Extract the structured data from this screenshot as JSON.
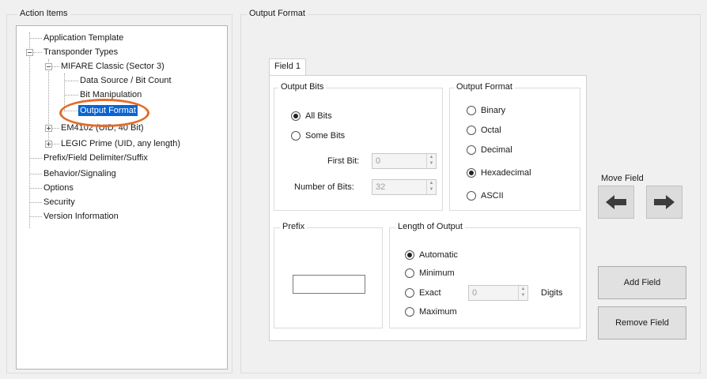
{
  "left_panel": {
    "title": "Action Items"
  },
  "tree": {
    "items": [
      {
        "label": "Application Template"
      },
      {
        "label": "Transponder Types"
      },
      {
        "label": "MIFARE Classic (Sector 3)"
      },
      {
        "label": "Data Source / Bit Count"
      },
      {
        "label": "Bit Manipulation"
      },
      {
        "label": "Output Format"
      },
      {
        "label": "EM4102 (UID, 40 Bit)"
      },
      {
        "label": "LEGIC Prime (UID, any length)"
      },
      {
        "label": "Prefix/Field Delimiter/Suffix"
      },
      {
        "label": "Behavior/Signaling"
      },
      {
        "label": "Options"
      },
      {
        "label": "Security"
      },
      {
        "label": "Version Information"
      }
    ]
  },
  "right_panel": {
    "title": "Output Format"
  },
  "tab": {
    "label": "Field 1"
  },
  "output_bits": {
    "title": "Output Bits",
    "all_bits": "All Bits",
    "some_bits": "Some Bits",
    "first_bit_label": "First Bit:",
    "first_bit_value": "0",
    "number_of_bits_label": "Number of Bits:",
    "number_of_bits_value": "32",
    "selected": "All Bits"
  },
  "output_format": {
    "title": "Output Format",
    "options": [
      "Binary",
      "Octal",
      "Decimal",
      "Hexadecimal",
      "ASCII"
    ],
    "selected": "Hexadecimal"
  },
  "prefix": {
    "title": "Prefix",
    "value": ""
  },
  "length_of_output": {
    "title": "Length of Output",
    "automatic": "Automatic",
    "minimum": "Minimum",
    "exact": "Exact",
    "exact_value": "0",
    "digits_label": "Digits",
    "maximum": "Maximum",
    "selected": "Automatic"
  },
  "move_field": {
    "label": "Move Field",
    "left_icon": "arrow-left-icon",
    "right_icon": "arrow-right-icon"
  },
  "buttons": {
    "add_field": "Add Field",
    "remove_field": "Remove Field"
  },
  "colors": {
    "selection": "#0a64d2",
    "highlight_ellipse": "#e36c2b",
    "arrow": "#3c3c3c"
  }
}
